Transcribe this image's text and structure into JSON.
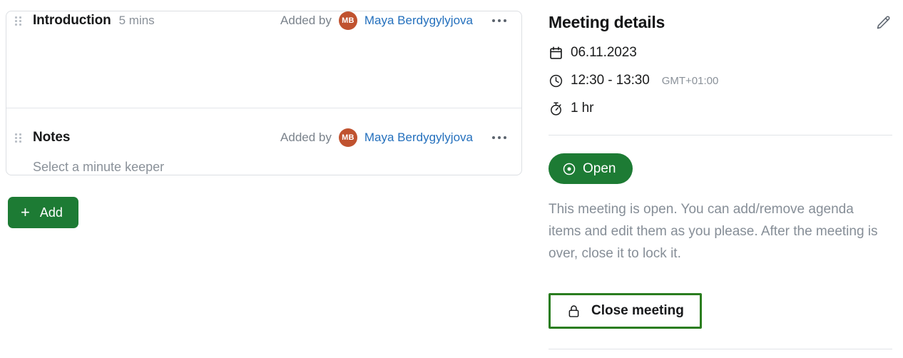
{
  "agenda": {
    "items": [
      {
        "drag_handle_icon": "drag-handle-icon",
        "title": "Introduction",
        "duration": "5 mins",
        "added_by_label": "Added by",
        "avatar_initials": "MB",
        "author": "Maya Berdygylyjova",
        "menu_icon": "ellipsis-icon"
      },
      {
        "drag_handle_icon": "drag-handle-icon",
        "title": "Notes",
        "duration": "",
        "added_by_label": "Added by",
        "avatar_initials": "MB",
        "author": "Maya Berdygylyjova",
        "menu_icon": "ellipsis-icon",
        "minute_keeper_placeholder": "Select a minute keeper"
      }
    ],
    "add_button": {
      "icon": "plus-icon",
      "label": "Add"
    }
  },
  "details": {
    "title": "Meeting details",
    "edit_icon": "pencil-icon",
    "date": {
      "icon": "calendar-icon",
      "value": "06.11.2023"
    },
    "time": {
      "icon": "clock-icon",
      "value": "12:30 - 13:30",
      "timezone": "GMT+01:00"
    },
    "duration": {
      "icon": "stopwatch-icon",
      "value": "1 hr"
    },
    "status": {
      "icon": "record-circle-icon",
      "label": "Open",
      "description": "This meeting is open. You can add/remove agenda items and edit them as you please. After the meeting is over, close it to lock it."
    },
    "close_button": {
      "icon": "lock-icon",
      "label": "Close meeting"
    }
  },
  "colors": {
    "green": "#1d7b34",
    "focus_green": "#2a7d1f",
    "link_blue": "#2470bd",
    "avatar_orange": "#c0522f",
    "muted_text": "#8a9199",
    "border": "#dcdfe3"
  }
}
